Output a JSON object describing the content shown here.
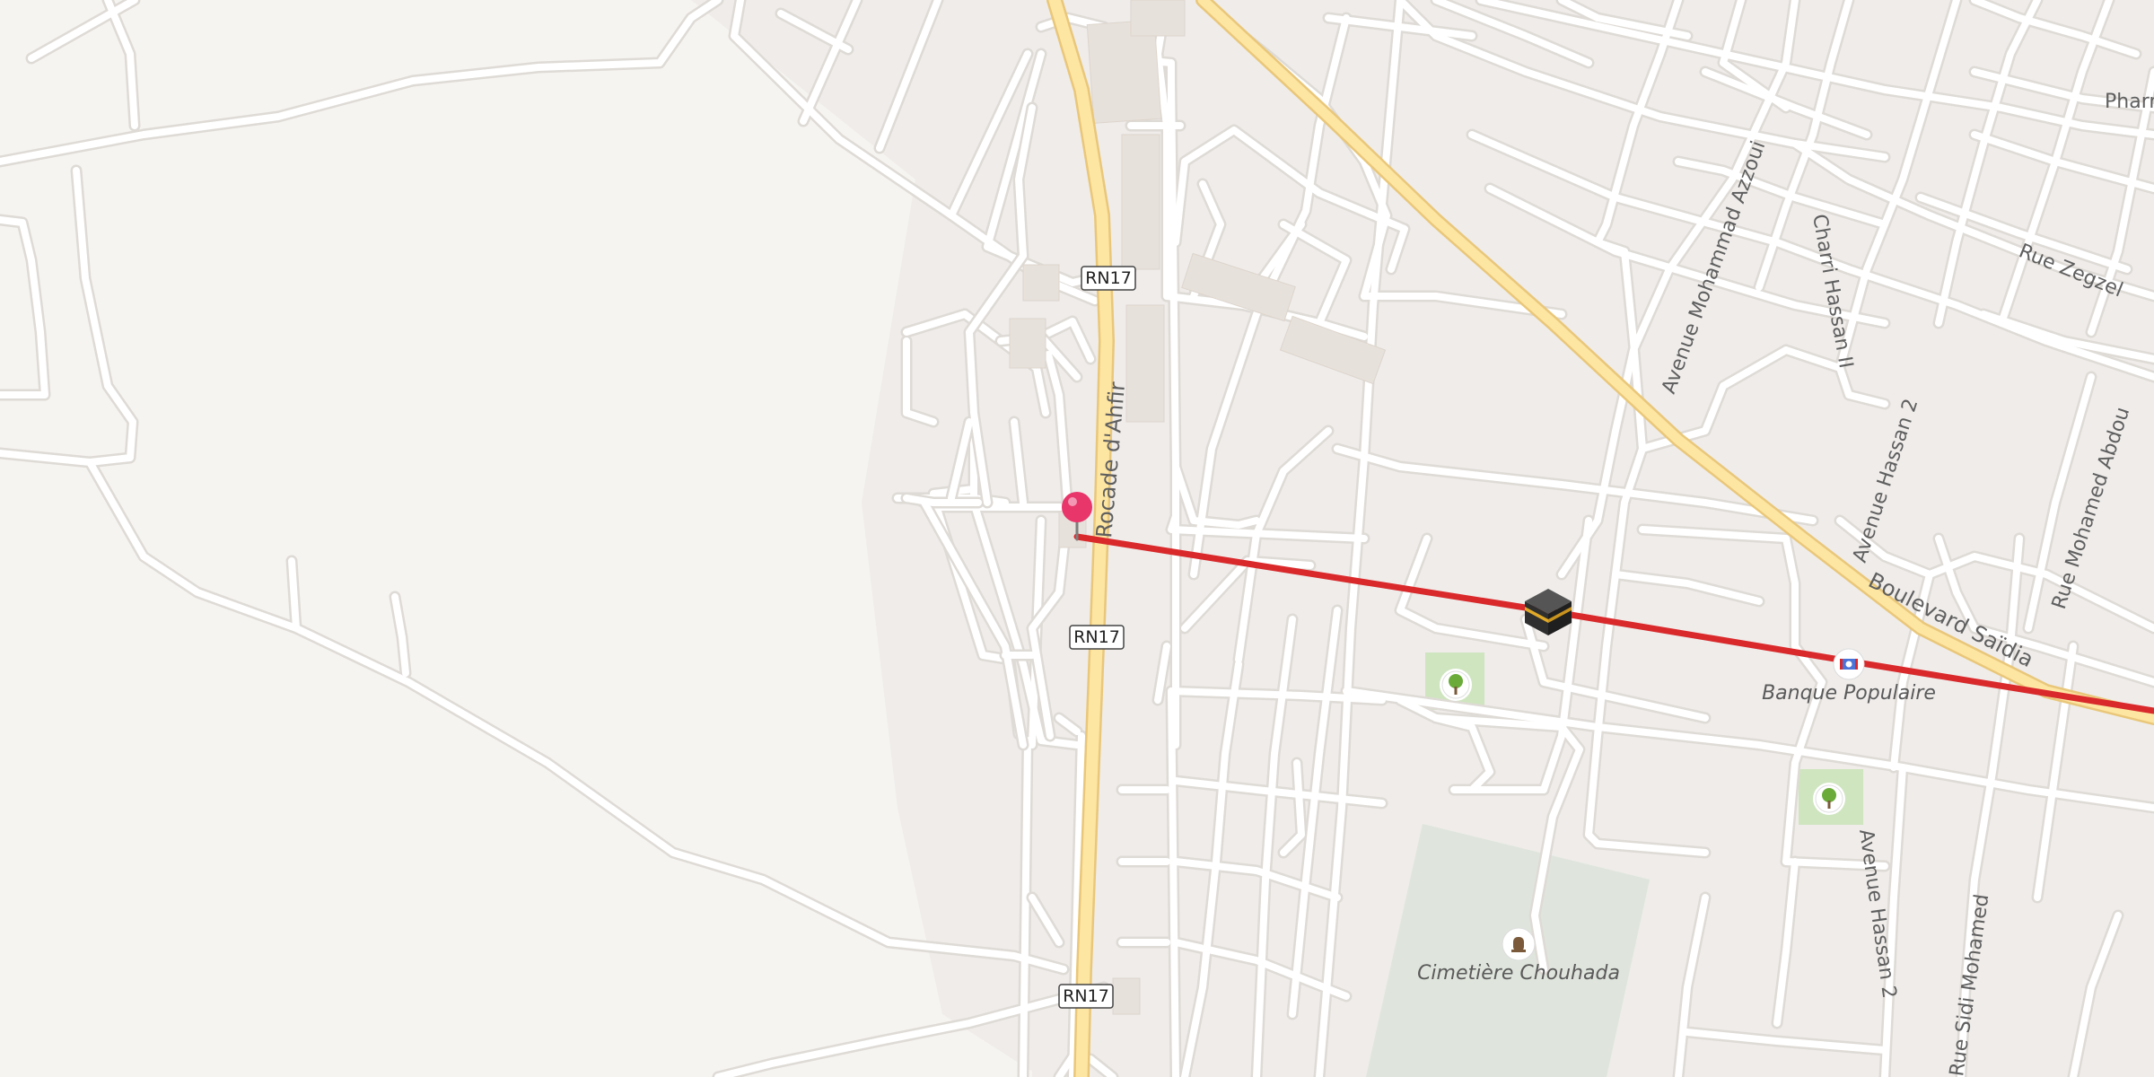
{
  "map": {
    "route_shields": [
      "RN17",
      "RN17",
      "RN17"
    ],
    "streets": {
      "rocade": "Rocade d'Ahfir",
      "boulevard": "Boulevard Saïdia",
      "azzoui": "Avenue Mohammad Azzoui",
      "charii": "Charri Hassan II",
      "hassan2_north": "Avenue Hassan 2",
      "hassan2_south": "Avenue Hassan 2",
      "zegzel": "Rue Zegzel",
      "abdou": "Rue Mohamed Abdou",
      "sidi": "Rue Sidi Mohamed",
      "pharm": "Pharm"
    },
    "pois": {
      "bank": "Banque Populaire",
      "cemetery": "Cimetière Chouhada"
    },
    "icons": {
      "pin": "location-pin-icon",
      "mosque": "kaaba-mosque-icon",
      "bank": "bank-icon",
      "park_1": "tree-park-icon",
      "park_2": "tree-park-icon",
      "cemetery": "cemetery-icon"
    },
    "colors": {
      "background": "#f6f4f1",
      "urban_area": "#efecea",
      "road": "#ffffff",
      "road_casing": "#dedad5",
      "highway": "#fde5a2",
      "highway_casing": "#e9c77a",
      "route_line": "#d9292b",
      "pin": "#e8356a",
      "park": "#cfe5bf",
      "cemetery_area": "#dfe5dc"
    }
  }
}
